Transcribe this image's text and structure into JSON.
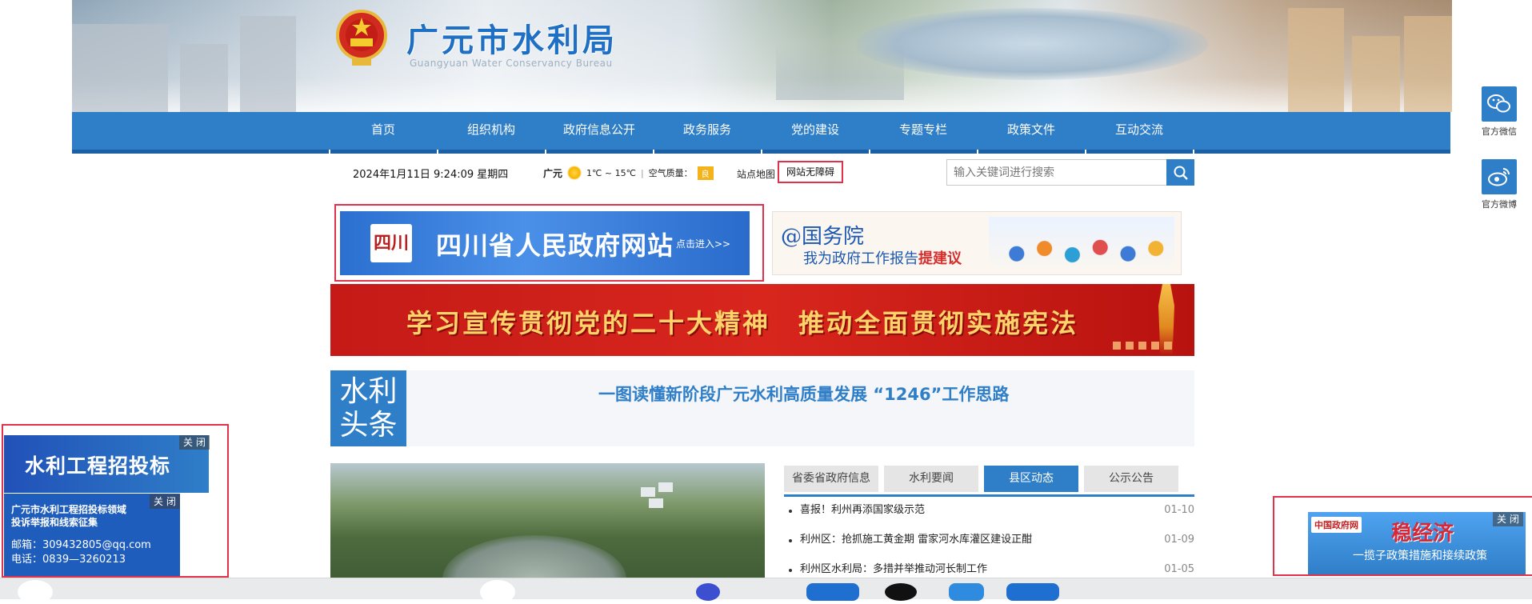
{
  "header": {
    "title": "广元市水利局",
    "subtitle": "Guangyuan Water Conservancy Bureau"
  },
  "nav": {
    "items": [
      {
        "label": "首页"
      },
      {
        "label": "组织机构"
      },
      {
        "label": "政府信息公开"
      },
      {
        "label": "政务服务"
      },
      {
        "label": "党的建设"
      },
      {
        "label": "专题专栏"
      },
      {
        "label": "政策文件"
      },
      {
        "label": "互动交流"
      }
    ]
  },
  "infobar": {
    "date": "2024年1月11日 9:24:09 星期四",
    "city": "广元",
    "temperature": "1℃ ~ 15℃",
    "air_label": "空气质量：",
    "air_value": "良",
    "sitemap": "站点地图",
    "accessibility": "网站无障碍"
  },
  "search": {
    "placeholder": "输入关键词进行搜索"
  },
  "promos": {
    "sichuan": {
      "seal": "四川",
      "title": "四川省人民政府网站",
      "enter": "点击进入>>"
    },
    "guowuyuan": {
      "line1": "@国务院",
      "line2": "我为政府工作报告",
      "line2_emph": "提建议"
    },
    "slogan": "学习宣传贯彻党的二十大精神　推动全面贯彻实施宪法"
  },
  "headline": {
    "badge_line1": "水利",
    "badge_line2": "头条",
    "text": "一图读懂新阶段广元水利高质量发展 “1246”工作思路"
  },
  "news_tabs": [
    {
      "label": "省委省政府信息",
      "active": false
    },
    {
      "label": "水利要闻",
      "active": false
    },
    {
      "label": "县区动态",
      "active": true
    },
    {
      "label": "公示公告",
      "active": false
    }
  ],
  "news": [
    {
      "title": "喜报！利州再添国家级示范",
      "date": "01-10"
    },
    {
      "title": "利州区：抢抓施工黄金期 雷家河水库灌区建设正酣",
      "date": "01-09"
    },
    {
      "title": "利州区水利局：多措并举推动河长制工作",
      "date": "01-05"
    }
  ],
  "social": [
    {
      "label": "官方微信",
      "icon": "wechat-icon"
    },
    {
      "label": "官方微博",
      "icon": "weibo-icon"
    }
  ],
  "float_left": {
    "ad1_title": "水利工程招投标",
    "ad2_line1": "广元市水利工程招投标领域",
    "ad2_line1b": "投诉举报和线索征集",
    "email": "邮箱：309432805@qq.com",
    "phone": "电话：0839—3260213",
    "close": "关 闭"
  },
  "float_right": {
    "logo": "中国政府网",
    "big": "稳经济",
    "small": "一揽子政策措施和接续政策",
    "close": "关 闭"
  },
  "colors": {
    "primary": "#2f7ec8",
    "highlight_border": "#e0334b",
    "slogan_bg": "#c51a17"
  }
}
